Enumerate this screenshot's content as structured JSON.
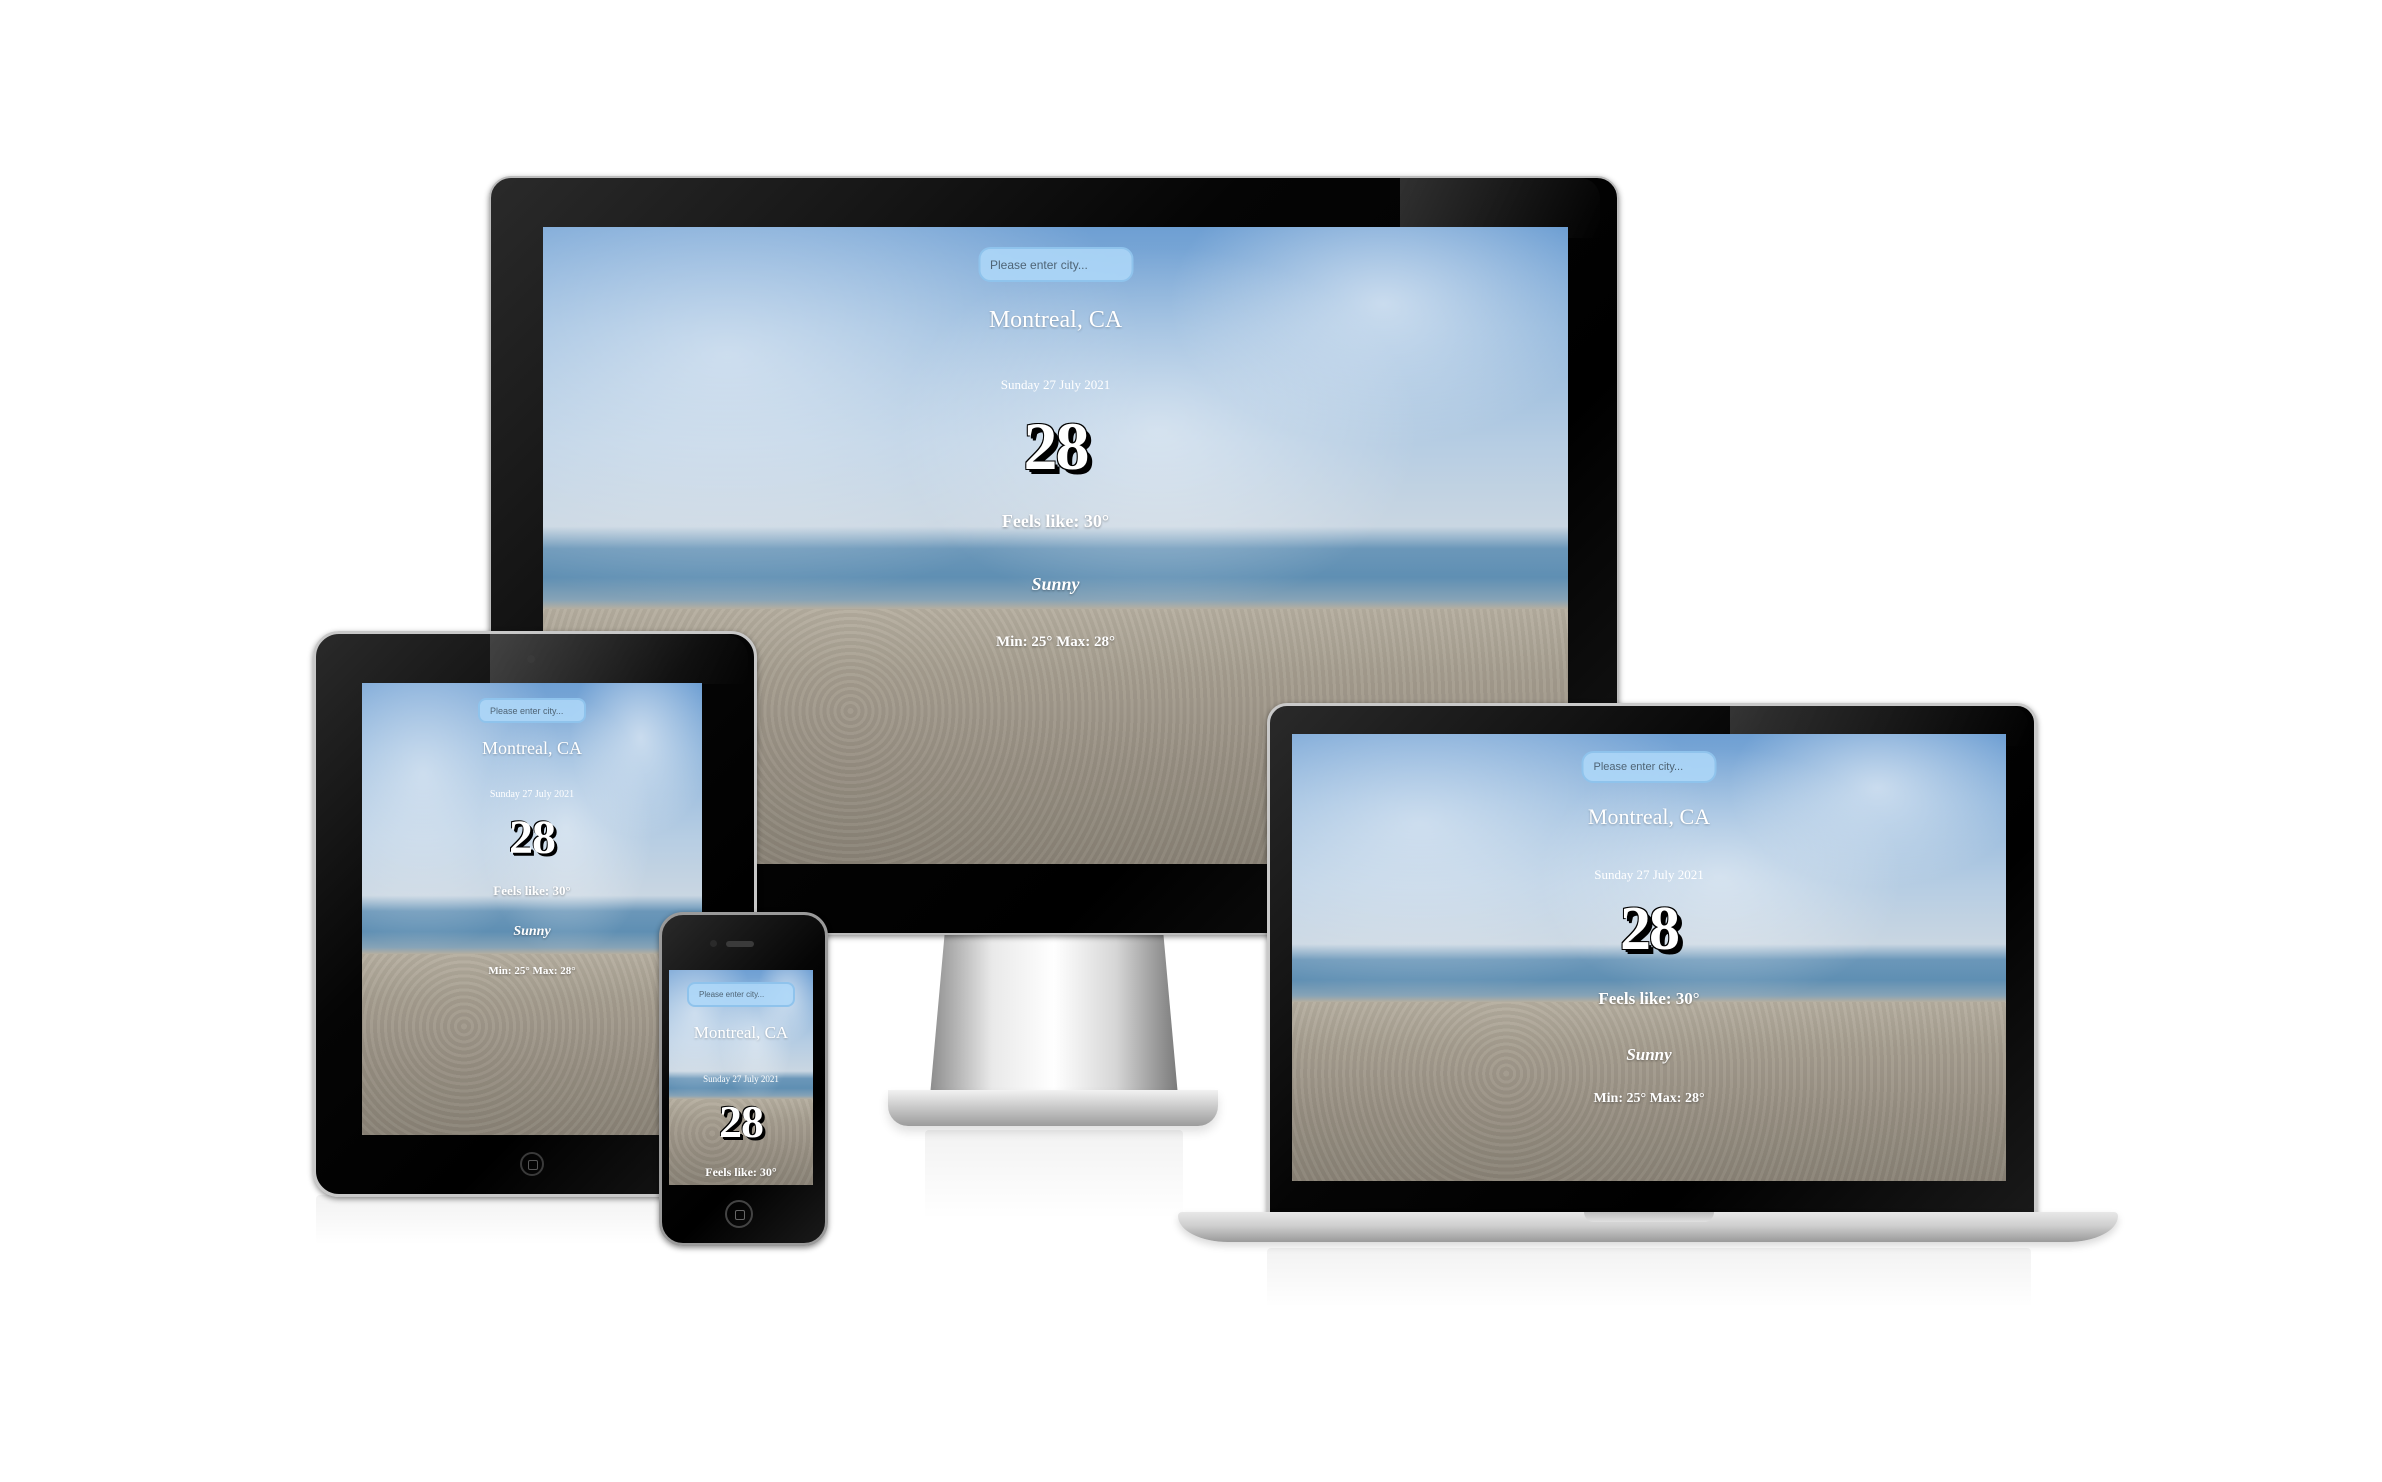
{
  "weather": {
    "search_placeholder": "Please enter city...",
    "city": "Montreal, CA",
    "date": "Sunday 27 July 2021",
    "temperature": "28",
    "feels_like": "Feels like: 30°",
    "condition": "Sunny",
    "min_max": "Min: 25° Max: 28°"
  },
  "colors": {
    "input_background": "#add7f8",
    "input_border": "#8fc3ec",
    "text": "#ffffff",
    "device_frame": "#000000"
  },
  "icons": {
    "tablet_home": "home-button-icon",
    "phone_home": "home-button-icon",
    "tablet_camera": "camera-icon",
    "phone_camera": "camera-icon"
  }
}
